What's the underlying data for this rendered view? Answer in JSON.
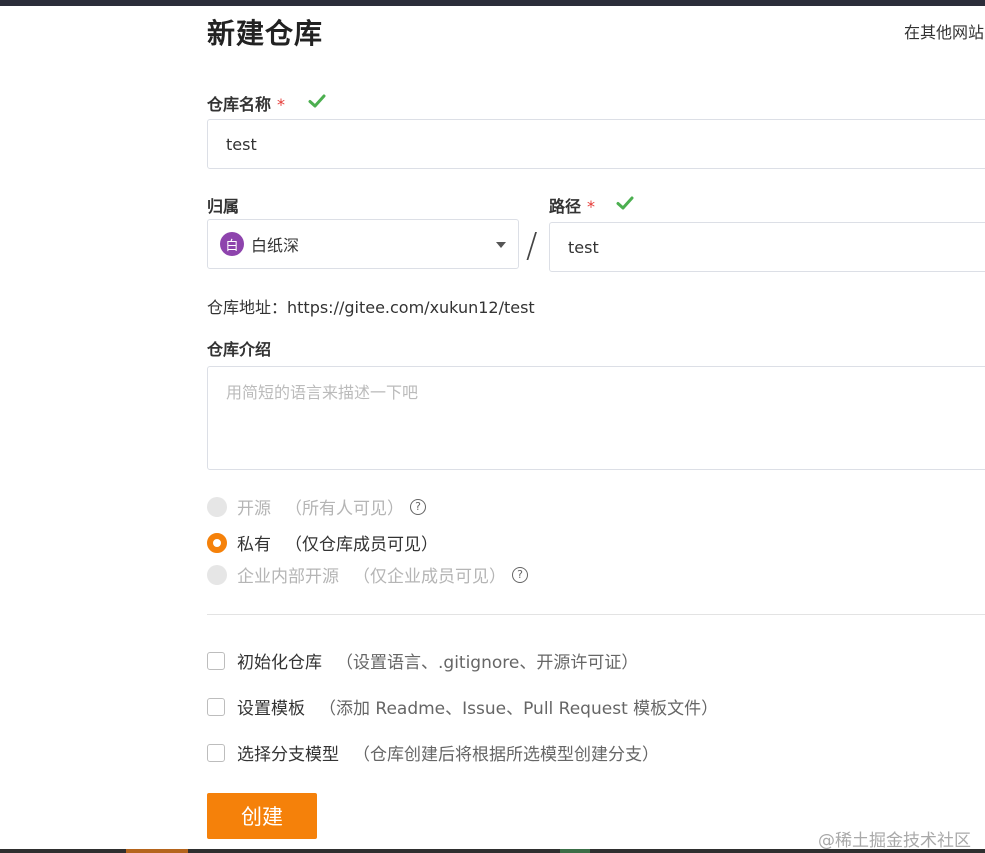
{
  "page": {
    "title": "新建仓库",
    "import_link": "在其他网站"
  },
  "form": {
    "repo_name": {
      "label": "仓库名称",
      "required_mark": "*",
      "value": "test"
    },
    "owner": {
      "label": "归属",
      "avatar_text": "白",
      "value": "白纸深"
    },
    "separator": "/",
    "path": {
      "label": "路径",
      "required_mark": "*",
      "value": "test"
    },
    "address": "仓库地址：https://gitee.com/xukun12/test",
    "description": {
      "label": "仓库介绍",
      "placeholder": "用简短的语言来描述一下吧"
    },
    "visibility": [
      {
        "label": "开源",
        "note": "（所有人可见）",
        "state": "disabled",
        "help": "?"
      },
      {
        "label": "私有",
        "note": "（仅仓库成员可见）",
        "state": "checked"
      },
      {
        "label": "企业内部开源",
        "note": "（仅企业成员可见）",
        "state": "disabled",
        "help": "?"
      }
    ],
    "options": [
      {
        "label": "初始化仓库",
        "note": "（设置语言、.gitignore、开源许可证）",
        "checked": false
      },
      {
        "label": "设置模板",
        "note": "（添加 Readme、Issue、Pull Request 模板文件）",
        "checked": false
      },
      {
        "label": "选择分支模型",
        "note": "（仓库创建后将根据所选模型创建分支）",
        "checked": false
      }
    ],
    "submit_label": "创建"
  },
  "watermark": "@稀土掘金技术社区",
  "colors": {
    "accent": "#f5810a",
    "valid": "#4caf50",
    "required": "#e53935",
    "avatar": "#8e44ad"
  },
  "icons": [
    "check-icon",
    "caret-down-icon",
    "help-icon"
  ]
}
